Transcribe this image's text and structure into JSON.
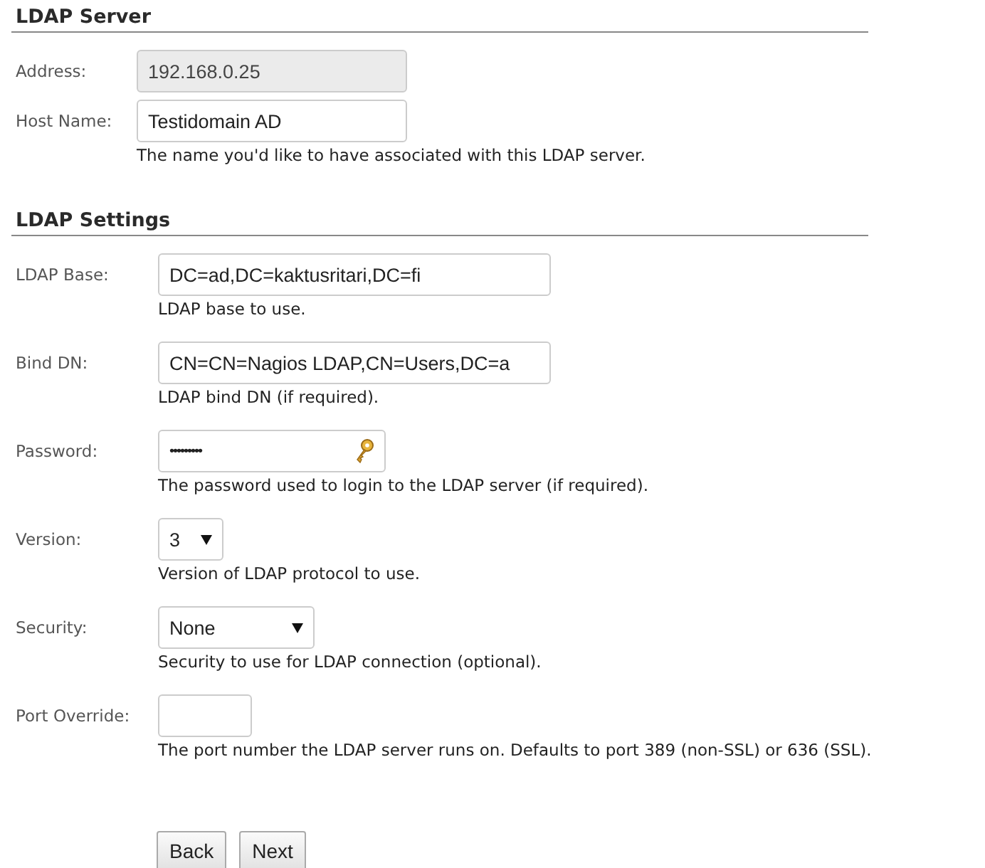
{
  "sections": [
    {
      "title": "LDAP Server",
      "fields": [
        {
          "kind": "text",
          "label": "Address:",
          "value": "192.168.0.25",
          "disabled": true
        },
        {
          "kind": "text",
          "label": "Host Name:",
          "value": "Testidomain AD",
          "disabled": false,
          "help": "The name you'd like to have associated with this LDAP server."
        }
      ]
    },
    {
      "title": "LDAP Settings",
      "fields": [
        {
          "kind": "text",
          "label": "LDAP Base:",
          "value": "DC=ad,DC=kaktusritari,DC=fi",
          "disabled": false,
          "help": "LDAP base to use."
        },
        {
          "kind": "text",
          "label": "Bind DN:",
          "value": "CN=CN=Nagios LDAP,CN=Users,DC=a",
          "disabled": false,
          "help": "LDAP bind DN (if required)."
        },
        {
          "kind": "password",
          "label": "Password:",
          "value": "•••••••••",
          "disabled": false,
          "help": "The password used to login to the LDAP server (if required)."
        },
        {
          "kind": "select",
          "label": "Version:",
          "value": "3",
          "disabled": false,
          "help": "Version of LDAP protocol to use."
        },
        {
          "kind": "select",
          "label": "Security:",
          "value": "None",
          "disabled": false,
          "help": "Security to use for LDAP connection (optional)."
        },
        {
          "kind": "short",
          "label": "Port Override:",
          "disabled": false,
          "help": "The port number the LDAP server runs on. Defaults to port 389 (non-SSL) or 636 (SSL)."
        }
      ]
    }
  ],
  "buttons": [
    "Back",
    "Next"
  ]
}
